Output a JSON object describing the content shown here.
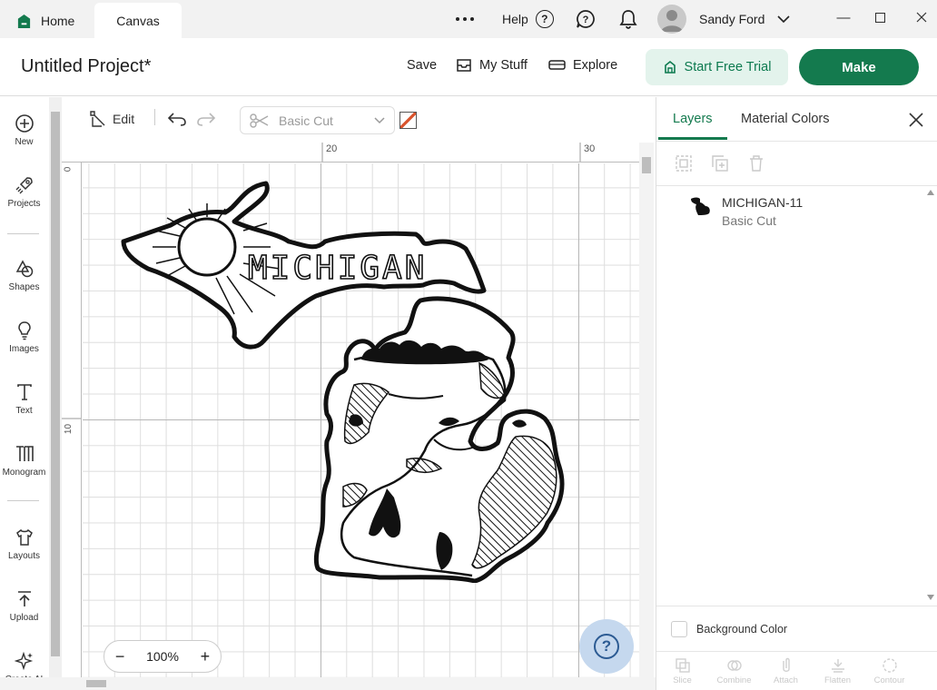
{
  "titlebar": {
    "tabs": [
      {
        "label": "Home"
      },
      {
        "label": "Canvas"
      }
    ],
    "more_icon": "more-horizontal-icon",
    "help_label": "Help",
    "user_name": "Sandy Ford"
  },
  "header": {
    "project_title": "Untitled Project*",
    "save_label": "Save",
    "my_stuff_label": "My Stuff",
    "explore_label": "Explore",
    "trial_label": "Start Free Trial",
    "make_label": "Make"
  },
  "left_toolbar": {
    "items": [
      {
        "label": "New",
        "icon": "plus-circle-icon"
      },
      {
        "label": "Projects",
        "icon": "rocket-icon"
      },
      {
        "label": "Shapes",
        "icon": "shapes-icon"
      },
      {
        "label": "Images",
        "icon": "lightbulb-icon"
      },
      {
        "label": "Text",
        "icon": "text-icon"
      },
      {
        "label": "Monogram",
        "icon": "monogram-icon"
      },
      {
        "label": "Layouts",
        "icon": "shirt-icon"
      },
      {
        "label": "Upload",
        "icon": "upload-icon"
      },
      {
        "label": "Create AI",
        "icon": "sparkle-icon"
      }
    ]
  },
  "canvas_toolbar": {
    "edit_label": "Edit",
    "operation": "Basic Cut",
    "swatch_color": "#d9532c"
  },
  "canvas": {
    "ruler_top_labels": [
      "20",
      "30"
    ],
    "ruler_left_labels": [
      "0",
      "10"
    ],
    "artwork_text": "MICHIGAN",
    "zoom": "100%"
  },
  "right_panel": {
    "tabs": [
      {
        "label": "Layers"
      },
      {
        "label": "Material Colors"
      }
    ],
    "layer": {
      "name": "MICHIGAN-11",
      "operation": "Basic Cut"
    },
    "background_label": "Background Color",
    "bottom_actions": [
      {
        "label": "Slice"
      },
      {
        "label": "Combine"
      },
      {
        "label": "Attach"
      },
      {
        "label": "Flatten"
      },
      {
        "label": "Contour"
      }
    ]
  },
  "colors": {
    "brand_green": "#147a4e",
    "trial_bg": "#e3f3ec",
    "help_fab_bg": "#c5d8ee"
  }
}
